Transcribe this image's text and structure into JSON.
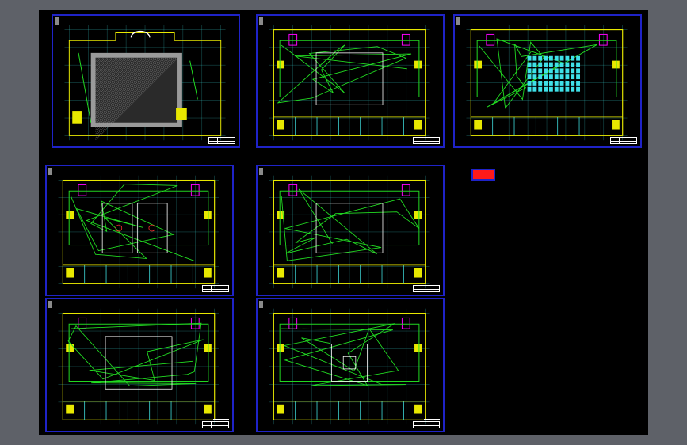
{
  "viewer": {
    "background": "#5e6168",
    "canvas_color": "#000000"
  },
  "sheets": [
    {
      "id": "sheet-1",
      "content": "roof-dome"
    },
    {
      "id": "sheet-2",
      "content": "plan-hall"
    },
    {
      "id": "sheet-3",
      "content": "plan-auditorium"
    },
    {
      "id": "sheet-4",
      "content": "plan-basketball"
    },
    {
      "id": "sheet-5",
      "content": "plan-open"
    },
    {
      "id": "sheet-6",
      "content": "plan-hall-lower"
    },
    {
      "id": "sheet-7",
      "content": "plan-ground"
    }
  ],
  "legend": {
    "color": "#ff1a1a",
    "frame_color": "#1f23c8"
  },
  "palette": {
    "frame": "#1f23c8",
    "wall": "#e8e800",
    "wiring": "#22dd22",
    "grid": "#40e0e0",
    "stair": "#ff00ff",
    "label": "#ffffff"
  }
}
